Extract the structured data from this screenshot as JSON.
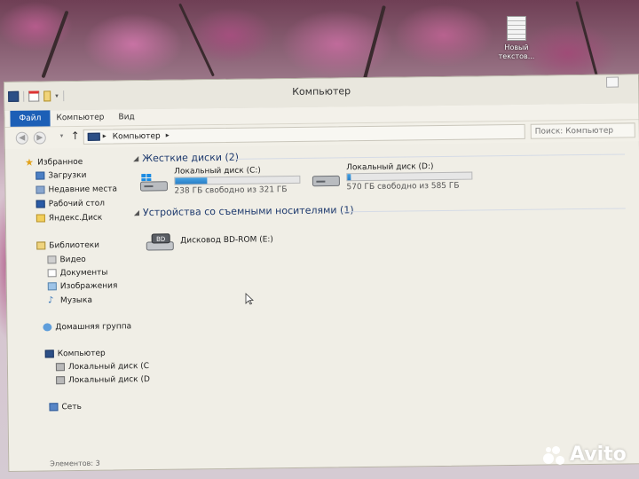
{
  "desktop": {
    "icon_label_1": "Новый",
    "icon_label_2": "текстов..."
  },
  "window": {
    "title": "Компьютер",
    "tabs": [
      "Файл",
      "Компьютер",
      "Вид"
    ],
    "address": {
      "crumb": "Компьютер"
    },
    "search": {
      "placeholder": "Поиск: Компьютер"
    }
  },
  "nav": {
    "favorites": "Избранное",
    "favorites_items": [
      "Загрузки",
      "Недавние места",
      "Рабочий стол",
      "Яндекс.Диск"
    ],
    "libraries": "Библиотеки",
    "libraries_items": [
      "Видео",
      "Документы",
      "Изображения",
      "Музыка"
    ],
    "homegroup": "Домашняя группа",
    "computer": "Компьютер",
    "computer_items": [
      "Локальный диск (C",
      "Локальный диск (D"
    ],
    "network": "Сеть"
  },
  "content": {
    "hdd_group": "Жесткие диски (2)",
    "removable_group": "Устройства со съемными носителями (1)",
    "drives": [
      {
        "name": "Локальный диск (C:)",
        "free": "238 ГБ свободно из 321 ГБ",
        "used_fraction": 0.26
      },
      {
        "name": "Локальный диск (D:)",
        "free": "570 ГБ свободно из 585 ГБ",
        "used_fraction": 0.03
      }
    ],
    "optical": {
      "name": "Дисковод BD-ROM (E:)",
      "badge": "BD"
    }
  },
  "status": {
    "items": "Элементов: 3"
  },
  "watermark": {
    "text": "Avito"
  },
  "colors": {
    "accent": "#1c5fb6",
    "drive_bar": "#2a7fc6",
    "group_header": "#1e3a6e"
  }
}
